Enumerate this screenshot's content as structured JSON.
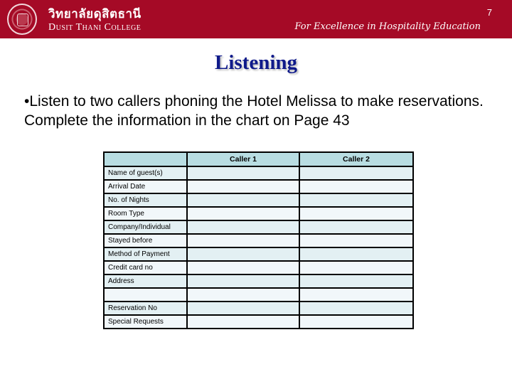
{
  "header": {
    "logo_icon": "college-seal-icon",
    "thai_name": "วิทยาลัยดุสิตธานี",
    "english_name": "Dusit Thani College",
    "page_number": "7",
    "tagline": "For Excellence in Hospitality Education",
    "brand_color": "#a50a26"
  },
  "slide": {
    "title": "Listening",
    "title_color": "#0f1a8a",
    "instruction": "•Listen to two callers phoning the Hotel Melissa to make reservations. Complete the information in the chart on Page 43"
  },
  "table": {
    "columns": [
      "",
      "Caller 1",
      "Caller 2"
    ],
    "header_color": "#b8dde2",
    "rows": [
      {
        "label": "Name of guest(s)",
        "caller1": "",
        "caller2": ""
      },
      {
        "label": "Arrival Date",
        "caller1": "",
        "caller2": ""
      },
      {
        "label": "No. of Nights",
        "caller1": "",
        "caller2": ""
      },
      {
        "label": "Room Type",
        "caller1": "",
        "caller2": ""
      },
      {
        "label": "Company/Individual",
        "caller1": "",
        "caller2": ""
      },
      {
        "label": "Stayed before",
        "caller1": "",
        "caller2": ""
      },
      {
        "label": "Method of Payment",
        "caller1": "",
        "caller2": ""
      },
      {
        "label": "Credit card no",
        "caller1": "",
        "caller2": ""
      },
      {
        "label": "Address",
        "caller1": "",
        "caller2": ""
      },
      {
        "label": "",
        "caller1": "",
        "caller2": ""
      },
      {
        "label": "Reservation No",
        "caller1": "",
        "caller2": ""
      },
      {
        "label": "Special Requests",
        "caller1": "",
        "caller2": ""
      }
    ]
  }
}
